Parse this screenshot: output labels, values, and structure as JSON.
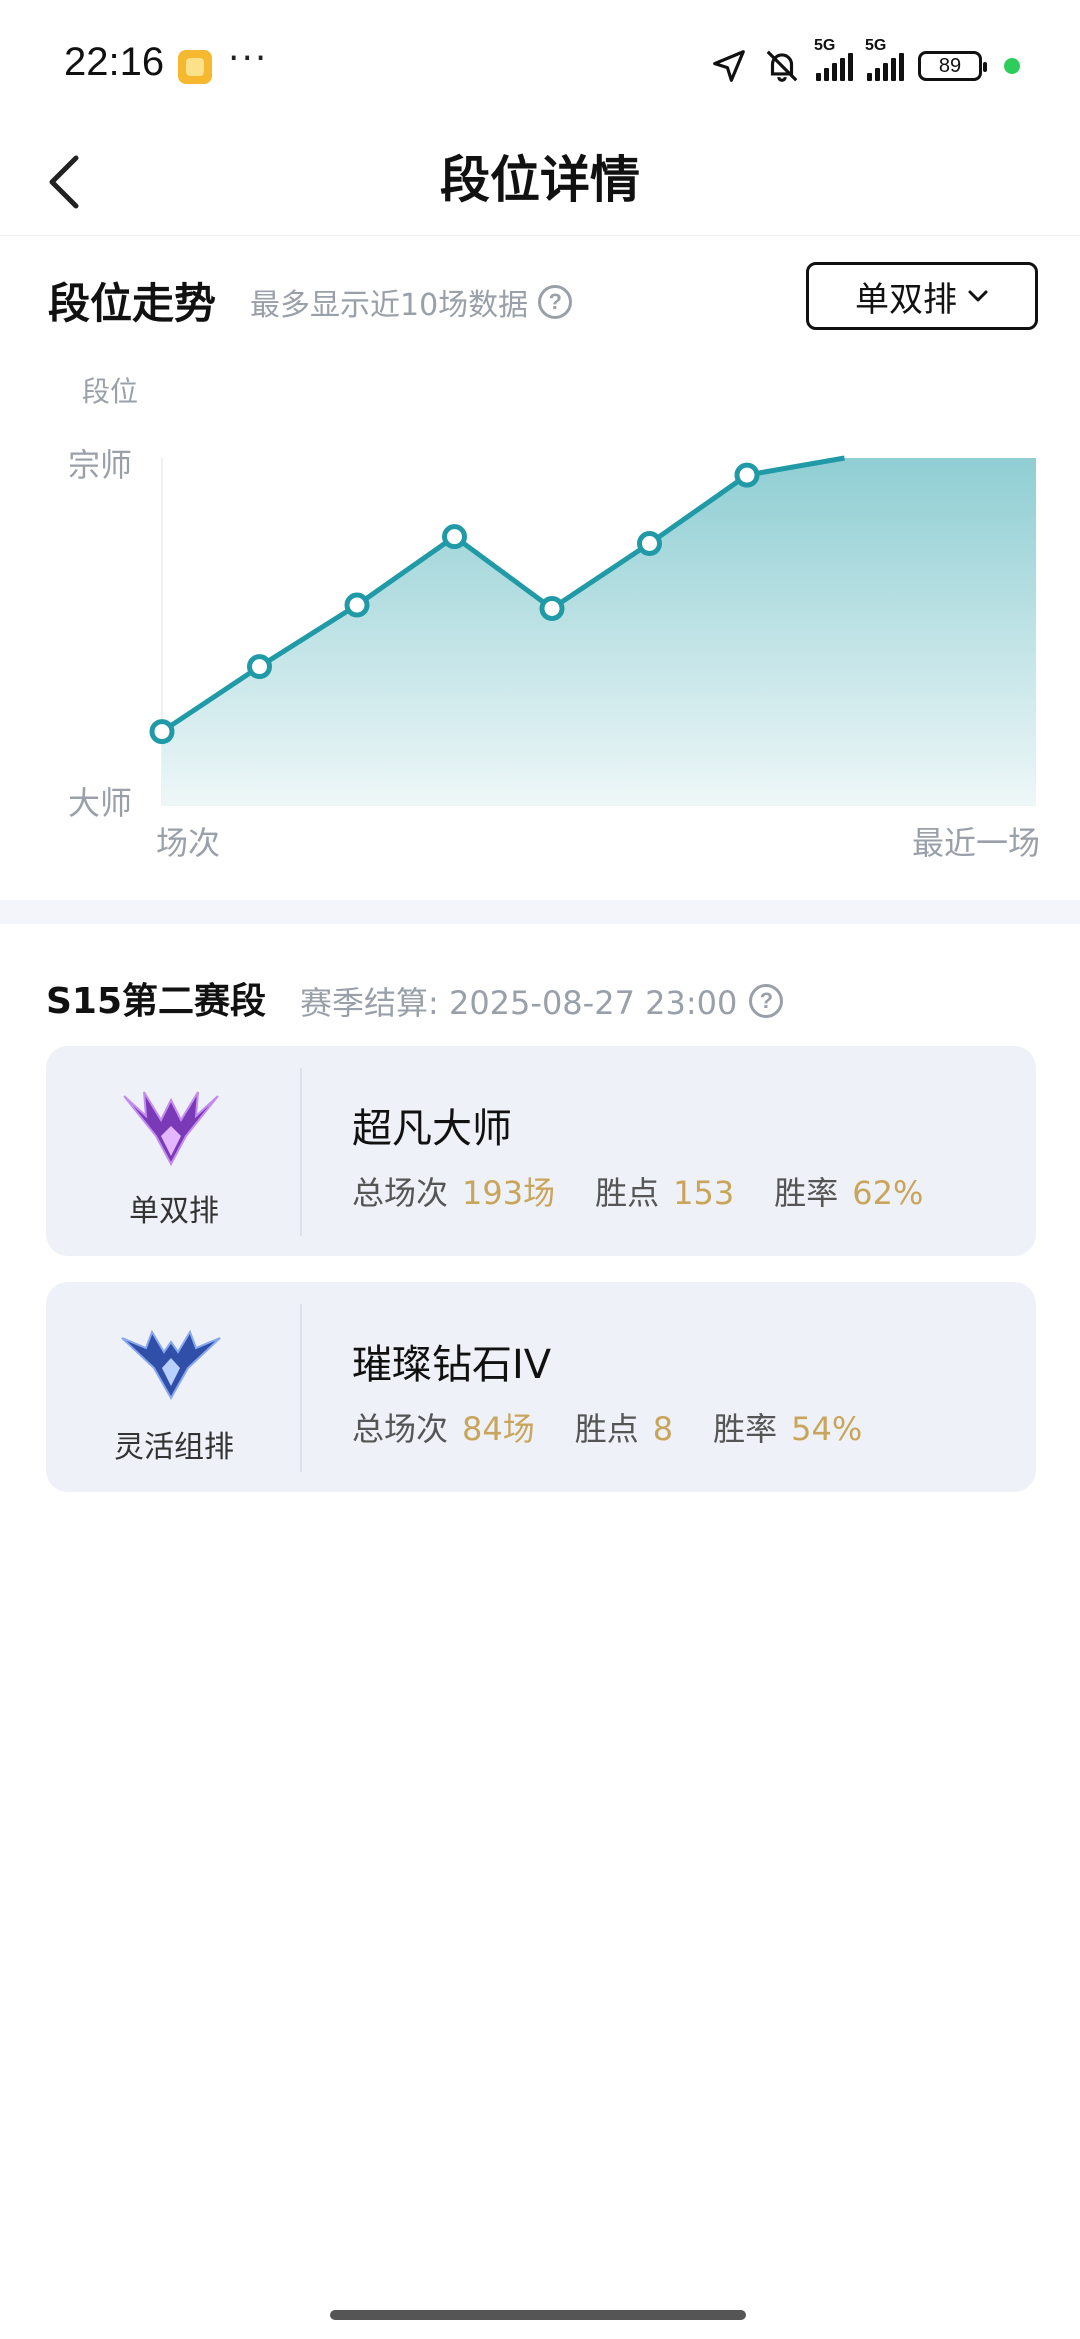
{
  "status_bar": {
    "time": "22:16",
    "more": "···",
    "battery": "89",
    "network": "5G"
  },
  "header": {
    "title": "段位详情"
  },
  "trend": {
    "title": "段位走势",
    "subtitle": "最多显示近10场数据",
    "help_symbol": "?",
    "select_value": "单双排"
  },
  "chart_data": {
    "type": "area",
    "ylabel": "段位",
    "y_tick_labels": [
      "宗师",
      "大师"
    ],
    "x_start_label": "场次",
    "x_end_label": "最近一场",
    "x": [
      1,
      2,
      3,
      4,
      5,
      6,
      7,
      8,
      9,
      10
    ],
    "values": [
      0.2,
      0.39,
      0.57,
      0.77,
      0.56,
      0.75,
      0.95,
      1.0,
      1.0,
      1.0
    ],
    "ylim": [
      0,
      1
    ],
    "color": "#1f9aa6",
    "fill_top": "#8fced3",
    "fill_bottom": "#eef7f8",
    "marked_points": 7
  },
  "season": {
    "title": "S15第二赛段",
    "settle_label": "赛季结算: 2025-08-27 23:00",
    "help_symbol": "?"
  },
  "queues": [
    {
      "name": "单双排",
      "rank": "超凡大师",
      "games_label": "总场次",
      "games": "193场",
      "lp_label": "胜点",
      "lp": "153",
      "winrate_label": "胜率",
      "winrate": "62%",
      "emblem_color": "#8a3fd1"
    },
    {
      "name": "灵活组排",
      "rank": "璀璨钻石IV",
      "games_label": "总场次",
      "games": "84场",
      "lp_label": "胜点",
      "lp": "8",
      "winrate_label": "胜率",
      "winrate": "54%",
      "emblem_color": "#3a5bd1"
    }
  ],
  "colors": {
    "accent_value": "#c9a55c",
    "muted": "#9aa0a9",
    "card_bg": "#eef1f7"
  }
}
